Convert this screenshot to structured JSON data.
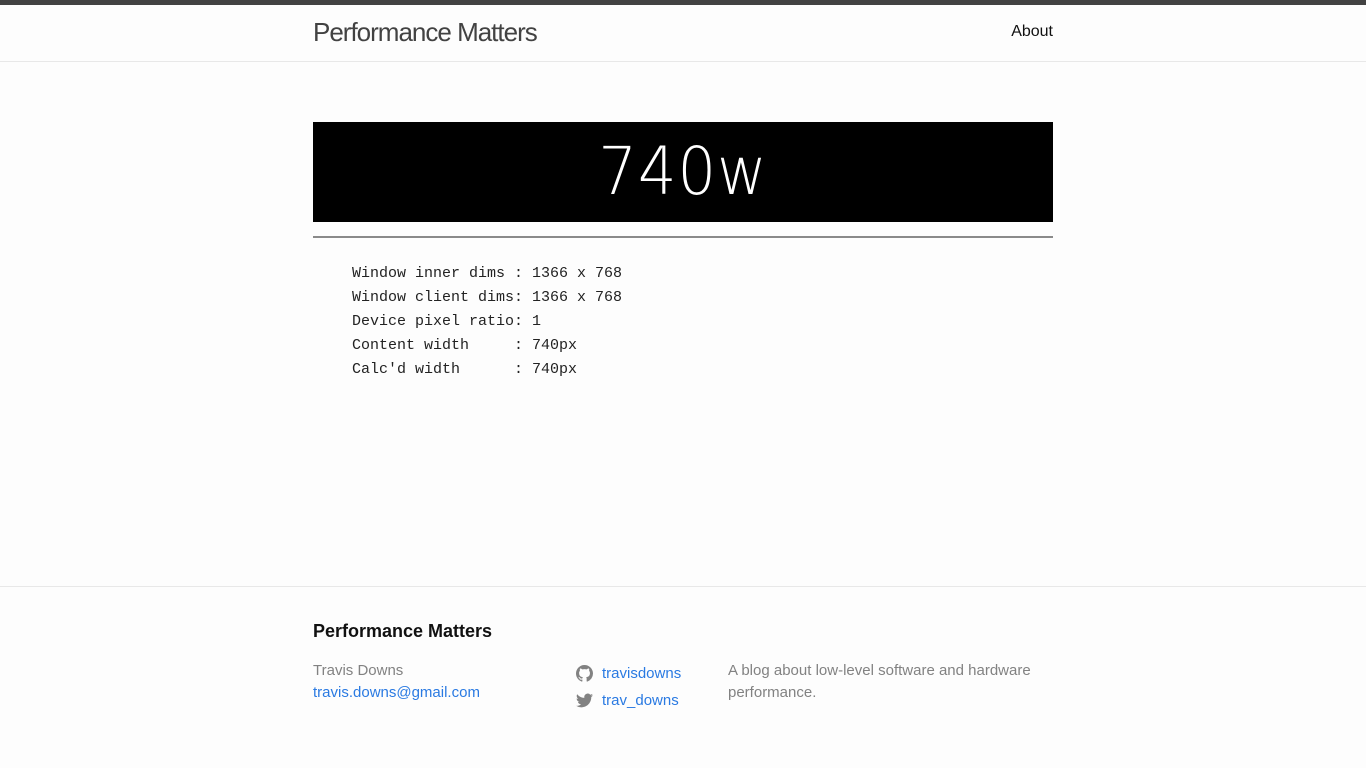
{
  "header": {
    "site_title": "Performance Matters",
    "nav": [
      {
        "label": "About"
      }
    ]
  },
  "banner": {
    "text": "740w"
  },
  "dims": {
    "lines": [
      "Window inner dims : 1366 x 768",
      "Window client dims: 1366 x 768",
      "Device pixel ratio: 1",
      "Content width     : 740px",
      "Calc'd width      : 740px"
    ]
  },
  "footer": {
    "heading": "Performance Matters",
    "author_name": "Travis Downs",
    "author_email": "travis.downs@gmail.com",
    "social": [
      {
        "icon": "github-icon",
        "label": "travisdowns"
      },
      {
        "icon": "twitter-icon",
        "label": "trav_downs"
      }
    ],
    "description": "A blog about low-level software and hardware performance."
  },
  "colors": {
    "accent_link": "#2a7ae2",
    "top_bar": "#424242",
    "banner_bg": "#000000",
    "muted_text": "#828282"
  }
}
